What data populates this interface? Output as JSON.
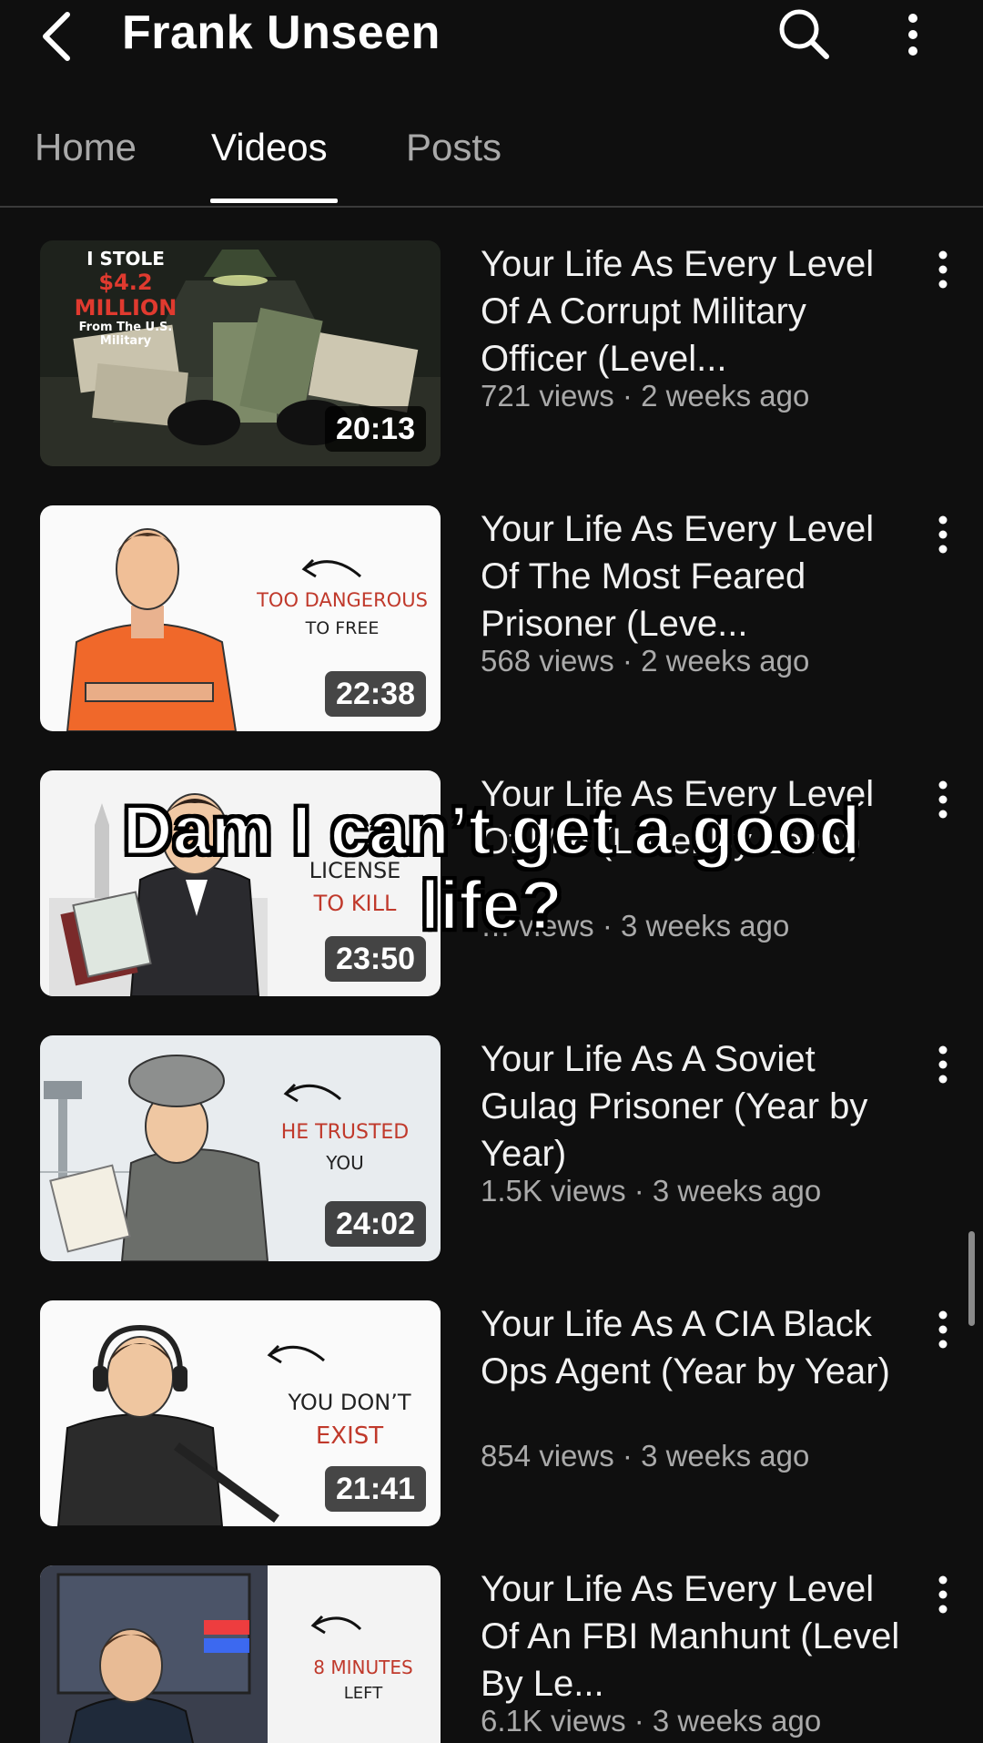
{
  "header": {
    "channel_name": "Frank Unseen",
    "icons": [
      "back-arrow-icon",
      "search-icon",
      "more-vertical-icon"
    ]
  },
  "tabs": [
    {
      "label": "Home",
      "active": false
    },
    {
      "label": "Videos",
      "active": true
    },
    {
      "label": "Posts",
      "active": false
    }
  ],
  "videos": [
    {
      "title": "Your Life As Every Level Of A Corrupt Military Officer (Level...",
      "meta": "721 views · 2 weeks ago",
      "duration": "20:13",
      "thumb_text": [
        "I STOLE",
        "$4.2 MILLION",
        "From The U.S. Military"
      ]
    },
    {
      "title": "Your Life As Every Level Of The Most Feared Prisoner (Leve...",
      "meta": "568 views · 2 weeks ago",
      "duration": "22:38",
      "thumb_text": [
        "TOO DANGEROUS",
        "TO FREE"
      ]
    },
    {
      "title": "Your Life As Every Level Of MI6 (Level By Level)",
      "meta": "… views · 3 weeks ago",
      "duration": "23:50",
      "thumb_text": [
        "LICENSE",
        "TO KILL"
      ]
    },
    {
      "title": "Your Life As A Soviet Gulag Prisoner (Year by Year)",
      "meta": "1.5K views · 3 weeks ago",
      "duration": "24:02",
      "thumb_text": [
        "HE TRUSTED",
        "YOU"
      ]
    },
    {
      "title": "Your Life As A CIA Black Ops Agent (Year by Year)",
      "meta": "854 views · 3 weeks ago",
      "duration": "21:41",
      "thumb_text": [
        "YOU DON’T",
        "EXIST"
      ]
    },
    {
      "title": "Your Life As Every Level Of An FBI Manhunt (Level By Le...",
      "meta": "6.1K views · 3 weeks ago",
      "duration": "",
      "thumb_text": [
        "8 MINUTES",
        "LEFT"
      ]
    }
  ],
  "overlay": {
    "line1": "Dam I can’t get a good",
    "line2": "life?"
  },
  "colors": {
    "background": "#0f0f0f",
    "text_primary": "#f1f1f1",
    "text_secondary": "#aaaaaa",
    "thumb_caption_red": "#c0392b"
  }
}
